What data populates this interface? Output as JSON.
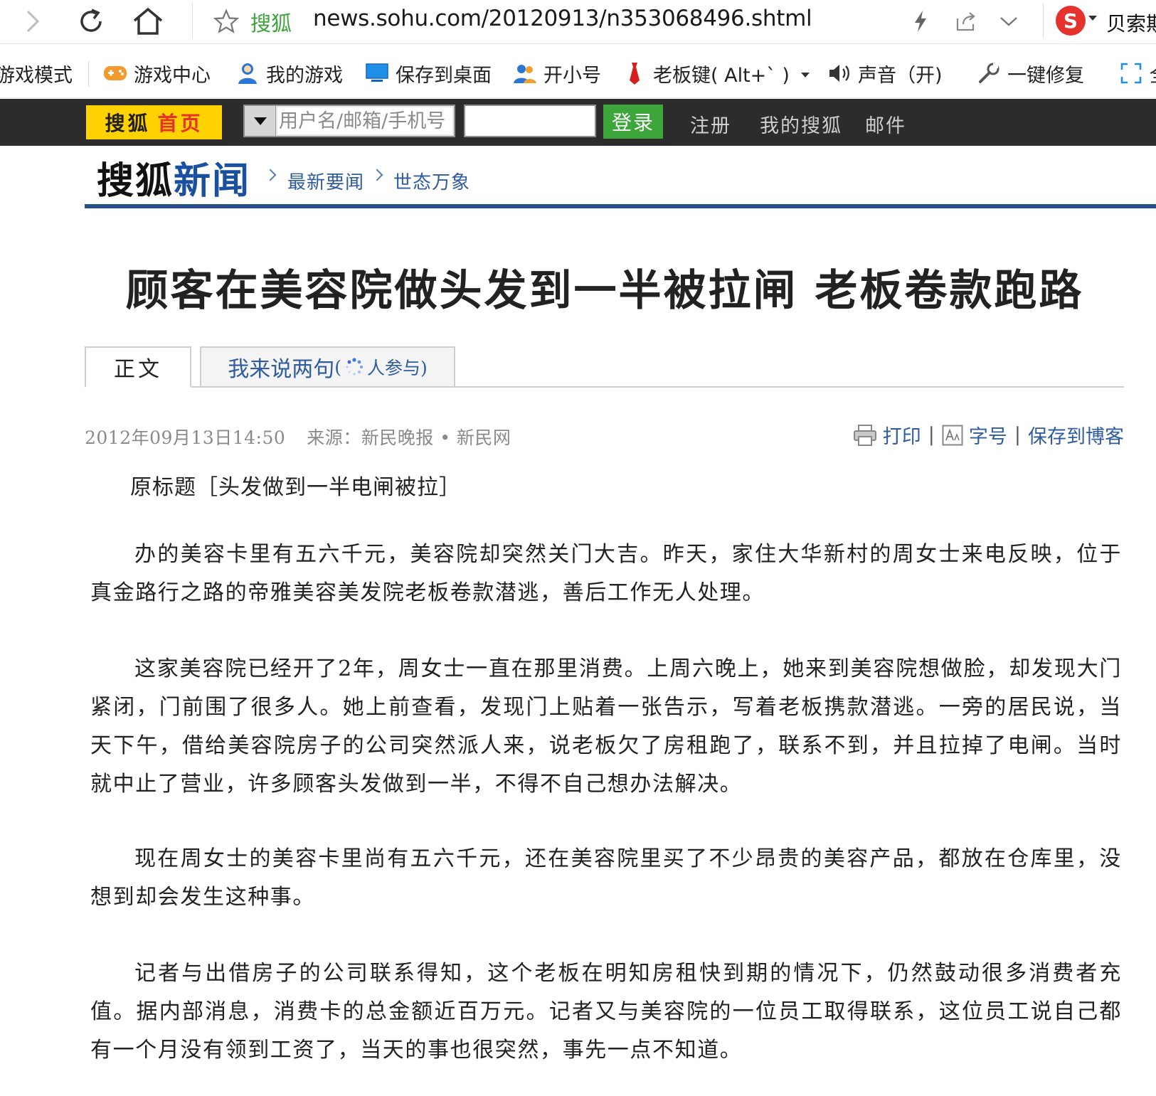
{
  "browser": {
    "site_name": "搜狐",
    "url": "news.sohu.com/20120913/n353068496.shtml",
    "search_label": "贝索斯",
    "icons": [
      "forward-icon",
      "refresh-icon",
      "home-icon",
      "star-icon",
      "lightning-icon",
      "share-icon",
      "chevron-down-icon",
      "sogou-icon"
    ]
  },
  "toolbar": {
    "game_mode": "游戏模式",
    "game_center": "游戏中心",
    "my_games": "我的游戏",
    "save_desktop": "保存到桌面",
    "open_alt": "开小号",
    "boss_key": "老板键( Alt+` )",
    "sound": "声音（开)",
    "repair": "一键修复",
    "fullscreen": "全"
  },
  "sohu_bar": {
    "home_a": "搜狐",
    "home_b": "首页",
    "username_placeholder": "用户名/邮箱/手机号",
    "login": "登录",
    "register": "注册",
    "my_sohu": "我的搜狐",
    "mail": "邮件"
  },
  "channel": {
    "logo_a": "搜狐",
    "logo_b": "新闻",
    "crumbs": [
      "最新要闻",
      "世态万象"
    ]
  },
  "article": {
    "title": "顾客在美容院做头发到一半被拉闸  老板卷款跑路",
    "tab_main": "正文",
    "tab_comment": "我来说两句",
    "tab_comment_open": "(",
    "tab_comment_suffix": "人参与)",
    "datetime": "2012年09月13日14:50",
    "source": "来源：新民晚报 • 新民网",
    "print": "打印",
    "font_size": "字号",
    "save_blog": "保存到博客",
    "original_title": "原标题［头发做到一半电闸被拉］",
    "paragraphs": [
      "办的美容卡里有五六千元，美容院却突然关门大吉。昨天，家住大华新村的周女士来电反映，位于真金路行之路的帝雅美容美发院老板卷款潜逃，善后工作无人处理。",
      "这家美容院已经开了2年，周女士一直在那里消费。上周六晚上，她来到美容院想做脸，却发现大门紧闭，门前围了很多人。她上前查看，发现门上贴着一张告示，写着老板携款潜逃。一旁的居民说，当天下午，借给美容院房子的公司突然派人来，说老板欠了房租跑了，联系不到，并且拉掉了电闸。当时就中止了营业，许多顾客头发做到一半，不得不自己想办法解决。",
      "现在周女士的美容卡里尚有五六千元，还在美容院里买了不少昂贵的美容产品，都放在仓库里，没想到却会发生这种事。",
      "记者与出借房子的公司联系得知，这个老板在明知房租快到期的情况下，仍然鼓动很多消费者充值。据内部消息，消费卡的总金额近百万元。记者又与美容院的一位员工取得联系，这位员工说自己都有一个月没有领到工资了，当天的事也很突然，事先一点不知道。"
    ]
  },
  "colors": {
    "sohu_yellow": "#ffd200",
    "sohu_red": "#e8312c",
    "login_green": "#3ca63a",
    "link_blue": "#2f5c9e",
    "rule_blue": "#28508c",
    "site_green": "#3da33a"
  }
}
